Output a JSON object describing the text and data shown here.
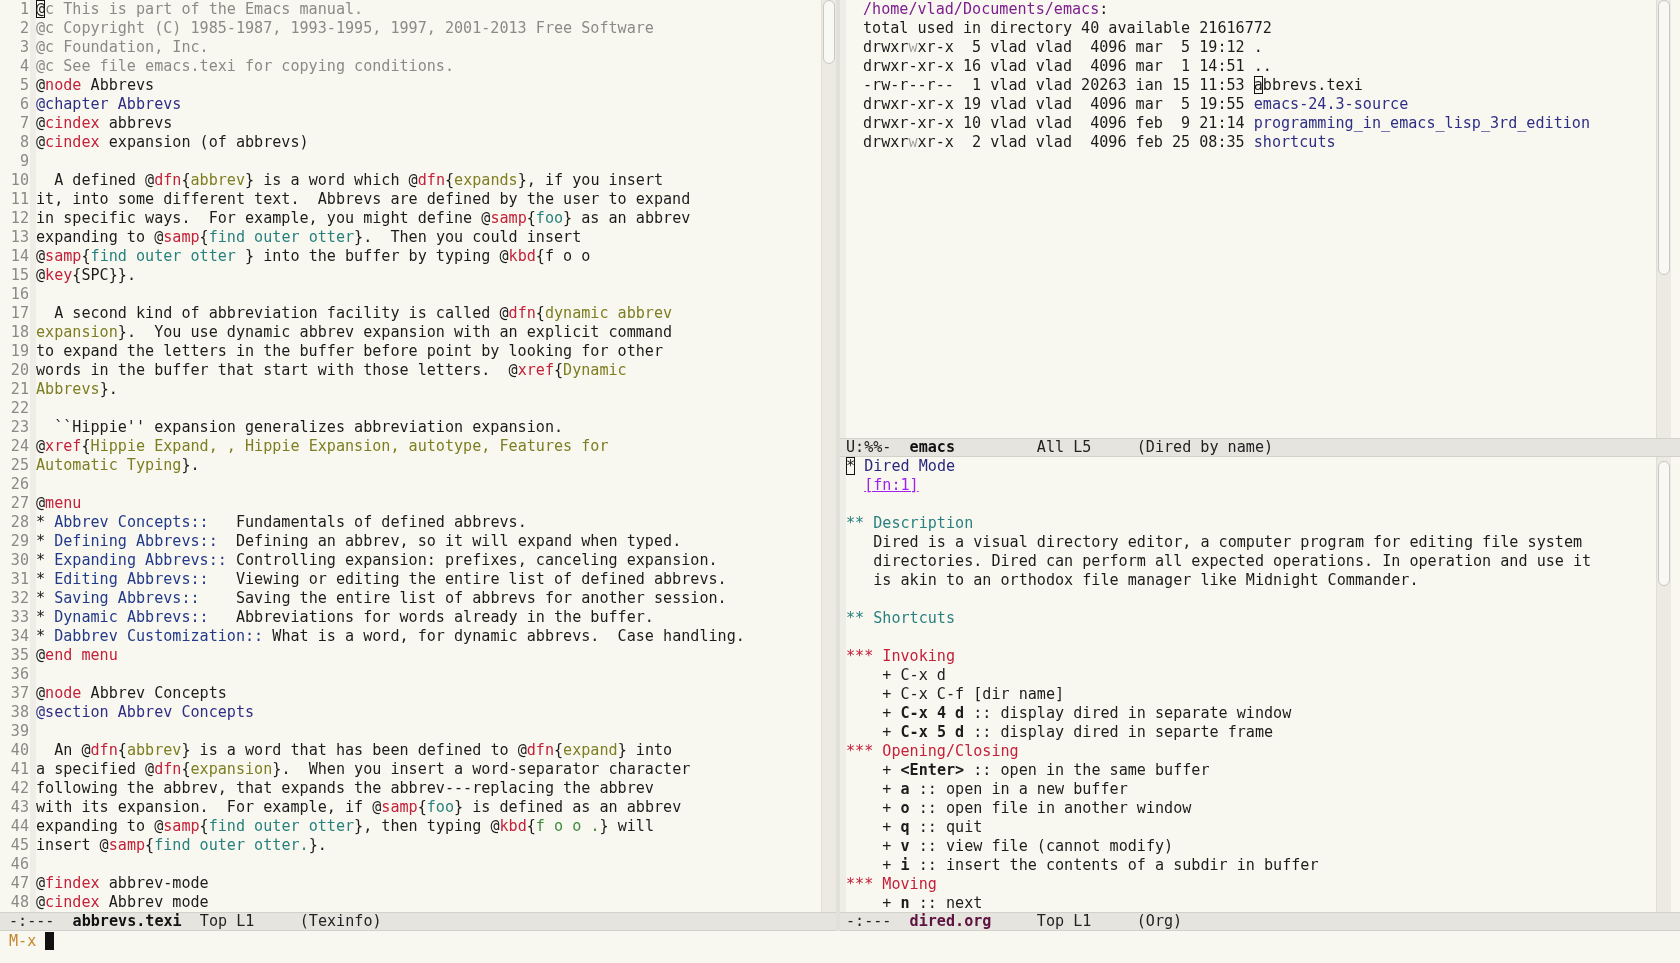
{
  "left_window": {
    "lines": [
      {
        "number": "1",
        "segments": [
          {
            "kind": "cursor",
            "text": "@"
          },
          {
            "kind": "comment",
            "text": "c This is part of the Emacs manual."
          }
        ]
      },
      {
        "number": "2",
        "segments": [
          {
            "kind": "comment",
            "text": "@c Copyright (C) 1985-1987, 1993-1995, 1997, 2001-2013 Free Software"
          }
        ]
      },
      {
        "number": "3",
        "segments": [
          {
            "kind": "comment",
            "text": "@c Foundation, Inc."
          }
        ]
      },
      {
        "number": "4",
        "segments": [
          {
            "kind": "comment",
            "text": "@c See file emacs.texi for copying conditions."
          }
        ]
      },
      {
        "number": "5",
        "segments": [
          {
            "kind": "plain",
            "text": "@"
          },
          {
            "kind": "keyword",
            "text": "node"
          },
          {
            "kind": "plain",
            "text": " Abbrevs"
          }
        ]
      },
      {
        "number": "6",
        "segments": [
          {
            "kind": "section",
            "text": "@chapter Abbrevs"
          }
        ]
      },
      {
        "number": "7",
        "segments": [
          {
            "kind": "plain",
            "text": "@"
          },
          {
            "kind": "keyword",
            "text": "cindex"
          },
          {
            "kind": "plain",
            "text": " abbrevs"
          }
        ]
      },
      {
        "number": "8",
        "segments": [
          {
            "kind": "plain",
            "text": "@"
          },
          {
            "kind": "keyword",
            "text": "cindex"
          },
          {
            "kind": "plain",
            "text": " expansion (of abbrevs)"
          }
        ]
      },
      {
        "number": "9"
      },
      {
        "number": "10",
        "segments": [
          {
            "kind": "plain",
            "text": "  A defined @"
          },
          {
            "kind": "keyword",
            "text": "dfn"
          },
          {
            "kind": "plain",
            "text": "{"
          },
          {
            "kind": "argument",
            "text": "abbrev"
          },
          {
            "kind": "plain",
            "text": "} is a word which @"
          },
          {
            "kind": "keyword",
            "text": "dfn"
          },
          {
            "kind": "plain",
            "text": "{"
          },
          {
            "kind": "argument",
            "text": "expands"
          },
          {
            "kind": "plain",
            "text": "}, if you insert"
          }
        ]
      },
      {
        "number": "11",
        "segments": [
          {
            "kind": "plain",
            "text": "it, into some different text.  Abbrevs are defined by the user to expand"
          }
        ]
      },
      {
        "number": "12",
        "segments": [
          {
            "kind": "plain",
            "text": "in specific ways.  For example, you might define @"
          },
          {
            "kind": "keyword",
            "text": "samp"
          },
          {
            "kind": "plain",
            "text": "{"
          },
          {
            "kind": "sample",
            "text": "foo"
          },
          {
            "kind": "plain",
            "text": "} as an abbrev"
          }
        ]
      },
      {
        "number": "13",
        "segments": [
          {
            "kind": "plain",
            "text": "expanding to @"
          },
          {
            "kind": "keyword",
            "text": "samp"
          },
          {
            "kind": "plain",
            "text": "{"
          },
          {
            "kind": "sample",
            "text": "find outer otter"
          },
          {
            "kind": "plain",
            "text": "}.  Then you could insert"
          }
        ]
      },
      {
        "number": "14",
        "segments": [
          {
            "kind": "plain",
            "text": "@"
          },
          {
            "kind": "keyword",
            "text": "samp"
          },
          {
            "kind": "plain",
            "text": "{"
          },
          {
            "kind": "sample",
            "text": "find outer otter "
          },
          {
            "kind": "plain",
            "text": "} into the buffer by typing @"
          },
          {
            "kind": "keyword",
            "text": "kbd"
          },
          {
            "kind": "plain",
            "text": "{f o o"
          }
        ]
      },
      {
        "number": "15",
        "segments": [
          {
            "kind": "plain",
            "text": "@"
          },
          {
            "kind": "keyword",
            "text": "key"
          },
          {
            "kind": "plain",
            "text": "{SPC}}."
          }
        ]
      },
      {
        "number": "16"
      },
      {
        "number": "17",
        "segments": [
          {
            "kind": "plain",
            "text": "  A second kind of abbreviation facility is called @"
          },
          {
            "kind": "keyword",
            "text": "dfn"
          },
          {
            "kind": "plain",
            "text": "{"
          },
          {
            "kind": "argument",
            "text": "dynamic abbrev"
          }
        ]
      },
      {
        "number": "18",
        "segments": [
          {
            "kind": "argument",
            "text": "expansion"
          },
          {
            "kind": "plain",
            "text": "}.  You use dynamic abbrev expansion with an explicit command"
          }
        ]
      },
      {
        "number": "19",
        "segments": [
          {
            "kind": "plain",
            "text": "to expand the letters in the buffer before point by looking for other"
          }
        ]
      },
      {
        "number": "20",
        "segments": [
          {
            "kind": "plain",
            "text": "words in the buffer that start with those letters.  @"
          },
          {
            "kind": "keyword",
            "text": "xref"
          },
          {
            "kind": "plain",
            "text": "{"
          },
          {
            "kind": "argument",
            "text": "Dynamic"
          }
        ]
      },
      {
        "number": "21",
        "segments": [
          {
            "kind": "argument",
            "text": "Abbrevs"
          },
          {
            "kind": "plain",
            "text": "}."
          }
        ]
      },
      {
        "number": "22"
      },
      {
        "number": "23",
        "segments": [
          {
            "kind": "plain",
            "text": "  ``Hippie'' expansion generalizes abbreviation expansion."
          }
        ]
      },
      {
        "number": "24",
        "segments": [
          {
            "kind": "plain",
            "text": "@"
          },
          {
            "kind": "keyword",
            "text": "xref"
          },
          {
            "kind": "plain",
            "text": "{"
          },
          {
            "kind": "argument",
            "text": "Hippie Expand, , Hippie Expansion, autotype, Features for"
          }
        ]
      },
      {
        "number": "25",
        "segments": [
          {
            "kind": "argument",
            "text": "Automatic Typing"
          },
          {
            "kind": "plain",
            "text": "}."
          }
        ]
      },
      {
        "number": "26"
      },
      {
        "number": "27",
        "segments": [
          {
            "kind": "plain",
            "text": "@"
          },
          {
            "kind": "keyword",
            "text": "menu"
          }
        ]
      },
      {
        "number": "28",
        "segments": [
          {
            "kind": "plain",
            "text": "* "
          },
          {
            "kind": "menu",
            "text": "Abbrev Concepts::"
          },
          {
            "kind": "plain",
            "text": "   Fundamentals of defined abbrevs."
          }
        ]
      },
      {
        "number": "29",
        "segments": [
          {
            "kind": "plain",
            "text": "* "
          },
          {
            "kind": "menu",
            "text": "Defining Abbrevs::"
          },
          {
            "kind": "plain",
            "text": "  Defining an abbrev, so it will expand when typed."
          }
        ]
      },
      {
        "number": "30",
        "segments": [
          {
            "kind": "plain",
            "text": "* "
          },
          {
            "kind": "menu",
            "text": "Expanding Abbrevs::"
          },
          {
            "kind": "plain",
            "text": " Controlling expansion: prefixes, canceling expansion."
          }
        ]
      },
      {
        "number": "31",
        "segments": [
          {
            "kind": "plain",
            "text": "* "
          },
          {
            "kind": "menu",
            "text": "Editing Abbrevs::"
          },
          {
            "kind": "plain",
            "text": "   Viewing or editing the entire list of defined abbrevs."
          }
        ]
      },
      {
        "number": "32",
        "segments": [
          {
            "kind": "plain",
            "text": "* "
          },
          {
            "kind": "menu",
            "text": "Saving Abbrevs::"
          },
          {
            "kind": "plain",
            "text": "    Saving the entire list of abbrevs for another session."
          }
        ]
      },
      {
        "number": "33",
        "segments": [
          {
            "kind": "plain",
            "text": "* "
          },
          {
            "kind": "menu",
            "text": "Dynamic Abbrevs::"
          },
          {
            "kind": "plain",
            "text": "   Abbreviations for words already in the buffer."
          }
        ]
      },
      {
        "number": "34",
        "segments": [
          {
            "kind": "plain",
            "text": "* "
          },
          {
            "kind": "menu",
            "text": "Dabbrev Customization::"
          },
          {
            "kind": "plain",
            "text": " What is a word, for dynamic abbrevs.  Case handling."
          }
        ]
      },
      {
        "number": "35",
        "segments": [
          {
            "kind": "plain",
            "text": "@"
          },
          {
            "kind": "keyword",
            "text": "end menu"
          }
        ]
      },
      {
        "number": "36"
      },
      {
        "number": "37",
        "segments": [
          {
            "kind": "plain",
            "text": "@"
          },
          {
            "kind": "keyword",
            "text": "node"
          },
          {
            "kind": "plain",
            "text": " Abbrev Concepts"
          }
        ]
      },
      {
        "number": "38",
        "segments": [
          {
            "kind": "section",
            "text": "@section Abbrev Concepts"
          }
        ]
      },
      {
        "number": "39"
      },
      {
        "number": "40",
        "segments": [
          {
            "kind": "plain",
            "text": "  An @"
          },
          {
            "kind": "keyword",
            "text": "dfn"
          },
          {
            "kind": "plain",
            "text": "{"
          },
          {
            "kind": "argument",
            "text": "abbrev"
          },
          {
            "kind": "plain",
            "text": "} is a word that has been defined to @"
          },
          {
            "kind": "keyword",
            "text": "dfn"
          },
          {
            "kind": "plain",
            "text": "{"
          },
          {
            "kind": "argument",
            "text": "expand"
          },
          {
            "kind": "plain",
            "text": "} into"
          }
        ]
      },
      {
        "number": "41",
        "segments": [
          {
            "kind": "plain",
            "text": "a specified @"
          },
          {
            "kind": "keyword",
            "text": "dfn"
          },
          {
            "kind": "plain",
            "text": "{"
          },
          {
            "kind": "argument",
            "text": "expansion"
          },
          {
            "kind": "plain",
            "text": "}.  When you insert a word-separator character"
          }
        ]
      },
      {
        "number": "42",
        "segments": [
          {
            "kind": "plain",
            "text": "following the abbrev, that expands the abbrev---replacing the abbrev"
          }
        ]
      },
      {
        "number": "43",
        "segments": [
          {
            "kind": "plain",
            "text": "with its expansion.  For example, if @"
          },
          {
            "kind": "keyword",
            "text": "samp"
          },
          {
            "kind": "plain",
            "text": "{"
          },
          {
            "kind": "sample",
            "text": "foo"
          },
          {
            "kind": "plain",
            "text": "} is defined as an abbrev"
          }
        ]
      },
      {
        "number": "44",
        "segments": [
          {
            "kind": "plain",
            "text": "expanding to @"
          },
          {
            "kind": "keyword",
            "text": "samp"
          },
          {
            "kind": "plain",
            "text": "{"
          },
          {
            "kind": "sample",
            "text": "find outer otter"
          },
          {
            "kind": "plain",
            "text": "}, then typing @"
          },
          {
            "kind": "keyword",
            "text": "kbd"
          },
          {
            "kind": "plain",
            "text": "{"
          },
          {
            "kind": "key",
            "text": "f o o ."
          },
          {
            "kind": "plain",
            "text": "} will"
          }
        ]
      },
      {
        "number": "45",
        "segments": [
          {
            "kind": "plain",
            "text": "insert @"
          },
          {
            "kind": "keyword",
            "text": "samp"
          },
          {
            "kind": "plain",
            "text": "{"
          },
          {
            "kind": "sample",
            "text": "find outer otter."
          },
          {
            "kind": "plain",
            "text": "}."
          }
        ]
      },
      {
        "number": "46"
      },
      {
        "number": "47",
        "segments": [
          {
            "kind": "plain",
            "text": "@"
          },
          {
            "kind": "keyword",
            "text": "findex"
          },
          {
            "kind": "plain",
            "text": " abbrev-mode"
          }
        ]
      },
      {
        "number": "48",
        "segments": [
          {
            "kind": "plain",
            "text": "@"
          },
          {
            "kind": "keyword",
            "text": "cindex"
          },
          {
            "kind": "plain",
            "text": " Abbrev mode"
          }
        ]
      }
    ],
    "mode_line": {
      "status": "-:---",
      "buffer": "abbrevs.texi",
      "kind": "bold",
      "position": "Top L1",
      "mode": "(Texinfo)"
    }
  },
  "dired_window": {
    "lines": [
      {
        "segments": [
          {
            "kind": "dir-header",
            "text": "/home/vlad/Documents/emacs"
          },
          {
            "kind": "plain",
            "text": ":"
          }
        ]
      },
      {
        "segments": [
          {
            "kind": "plain",
            "text": "total used in directory 40 available 21616772"
          }
        ]
      },
      {
        "segments": [
          {
            "kind": "plain",
            "text": "drwxr"
          },
          {
            "kind": "dim",
            "text": "w"
          },
          {
            "kind": "plain",
            "text": "xr-x  5 vlad vlad  4096 mar  5 19:12 ."
          }
        ]
      },
      {
        "segments": [
          {
            "kind": "plain",
            "text": "drwxr-xr-x 16 vlad vlad  4096 mar  1 14:51 .."
          }
        ]
      },
      {
        "segments": [
          {
            "kind": "plain",
            "text": "-rw-r--r--  1 vlad vlad 20263 ian 15 11:53 "
          },
          {
            "kind": "cursor",
            "text": "a"
          },
          {
            "kind": "plain",
            "text": "bbrevs.texi"
          }
        ]
      },
      {
        "segments": [
          {
            "kind": "plain",
            "text": "drwxr-xr-x 19 vlad vlad  4096 mar  5 19:55 "
          },
          {
            "kind": "directory",
            "text": "emacs-24.3-source"
          }
        ]
      },
      {
        "segments": [
          {
            "kind": "plain",
            "text": "drwxr-xr-x 10 vlad vlad  4096 feb  9 21:14 "
          },
          {
            "kind": "directory",
            "text": "programming_in_emacs_lisp_3rd_edition"
          }
        ]
      },
      {
        "segments": [
          {
            "kind": "plain",
            "text": "drwxr"
          },
          {
            "kind": "dim",
            "text": "w"
          },
          {
            "kind": "plain",
            "text": "xr-x  2 vlad vlad  4096 feb 25 08:35 "
          },
          {
            "kind": "directory",
            "text": "shortcuts"
          }
        ]
      }
    ],
    "mode_line": {
      "status": "U:%%-",
      "buffer": "emacs",
      "kind": "bold",
      "position": "All L5",
      "mode": "(Dired by name)"
    }
  },
  "org_window": {
    "lines": [
      {
        "kind": "text",
        "segments": [
          {
            "kind": "cursor",
            "text": "*"
          },
          {
            "kind": "heading-1",
            "text": " Dired Mode"
          }
        ]
      },
      {
        "kind": "footnote",
        "segments": [
          {
            "kind": "link",
            "text": "[fn:1]"
          }
        ]
      },
      {
        "kind": "blank"
      },
      {
        "kind": "text",
        "segments": [
          {
            "kind": "heading-2",
            "text": "** Description"
          }
        ]
      },
      {
        "kind": "text",
        "segments": [
          {
            "kind": "plain",
            "text": "   Dired is a visual directory editor, a computer program for editing file system"
          }
        ]
      },
      {
        "kind": "text",
        "segments": [
          {
            "kind": "plain",
            "text": "   directories. Dired can perform all expected operations. In operation and use it"
          }
        ]
      },
      {
        "kind": "text",
        "segments": [
          {
            "kind": "plain",
            "text": "   is akin to an orthodox file manager like Midnight Commander."
          }
        ]
      },
      {
        "kind": "blank"
      },
      {
        "kind": "text",
        "segments": [
          {
            "kind": "heading-2",
            "text": "** Shortcuts"
          }
        ]
      },
      {
        "kind": "blank"
      },
      {
        "kind": "text",
        "segments": [
          {
            "kind": "heading-3",
            "text": "*** Invoking"
          }
        ]
      },
      {
        "kind": "text",
        "segments": [
          {
            "kind": "plain",
            "text": "    + C-x d"
          }
        ]
      },
      {
        "kind": "text",
        "segments": [
          {
            "kind": "plain",
            "text": "    + C-x C-f [dir name]"
          }
        ]
      },
      {
        "kind": "text",
        "segments": [
          {
            "kind": "plain",
            "text": "    + "
          },
          {
            "kind": "bold",
            "text": "C-x 4 d"
          },
          {
            "kind": "plain",
            "text": " :: display dired in separate window"
          }
        ]
      },
      {
        "kind": "text",
        "segments": [
          {
            "kind": "plain",
            "text": "    + "
          },
          {
            "kind": "bold",
            "text": "C-x 5 d"
          },
          {
            "kind": "plain",
            "text": " :: display dired in separte frame"
          }
        ]
      },
      {
        "kind": "text",
        "segments": [
          {
            "kind": "heading-3",
            "text": "*** Opening/Closing"
          }
        ]
      },
      {
        "kind": "text",
        "segments": [
          {
            "kind": "plain",
            "text": "    + "
          },
          {
            "kind": "bold",
            "text": "<Enter>"
          },
          {
            "kind": "plain",
            "text": " :: open in the same buffer"
          }
        ]
      },
      {
        "kind": "text",
        "segments": [
          {
            "kind": "plain",
            "text": "    + "
          },
          {
            "kind": "bold",
            "text": "a"
          },
          {
            "kind": "plain",
            "text": " :: open in a new buffer"
          }
        ]
      },
      {
        "kind": "text",
        "segments": [
          {
            "kind": "plain",
            "text": "    + "
          },
          {
            "kind": "bold",
            "text": "o"
          },
          {
            "kind": "plain",
            "text": " :: open file in another window"
          }
        ]
      },
      {
        "kind": "text",
        "segments": [
          {
            "kind": "plain",
            "text": "    + "
          },
          {
            "kind": "bold",
            "text": "q"
          },
          {
            "kind": "plain",
            "text": " :: quit"
          }
        ]
      },
      {
        "kind": "text",
        "segments": [
          {
            "kind": "plain",
            "text": "    + "
          },
          {
            "kind": "bold",
            "text": "v"
          },
          {
            "kind": "plain",
            "text": " :: view file (cannot modify)"
          }
        ]
      },
      {
        "kind": "text",
        "segments": [
          {
            "kind": "plain",
            "text": "    + "
          },
          {
            "kind": "bold",
            "text": "i"
          },
          {
            "kind": "plain",
            "text": " :: insert the contents of a subdir in buffer"
          }
        ]
      },
      {
        "kind": "text",
        "segments": [
          {
            "kind": "heading-3",
            "text": "*** Moving"
          }
        ]
      },
      {
        "kind": "text",
        "segments": [
          {
            "kind": "plain",
            "text": "    + "
          },
          {
            "kind": "bold",
            "text": "n"
          },
          {
            "kind": "plain",
            "text": " :: next"
          }
        ]
      }
    ],
    "mode_line": {
      "status": "-:---",
      "buffer": "dired.org",
      "kind": "accent",
      "position": "Top L1",
      "mode": "(Org)"
    }
  },
  "minibuffer": {
    "prompt": "M-x"
  }
}
